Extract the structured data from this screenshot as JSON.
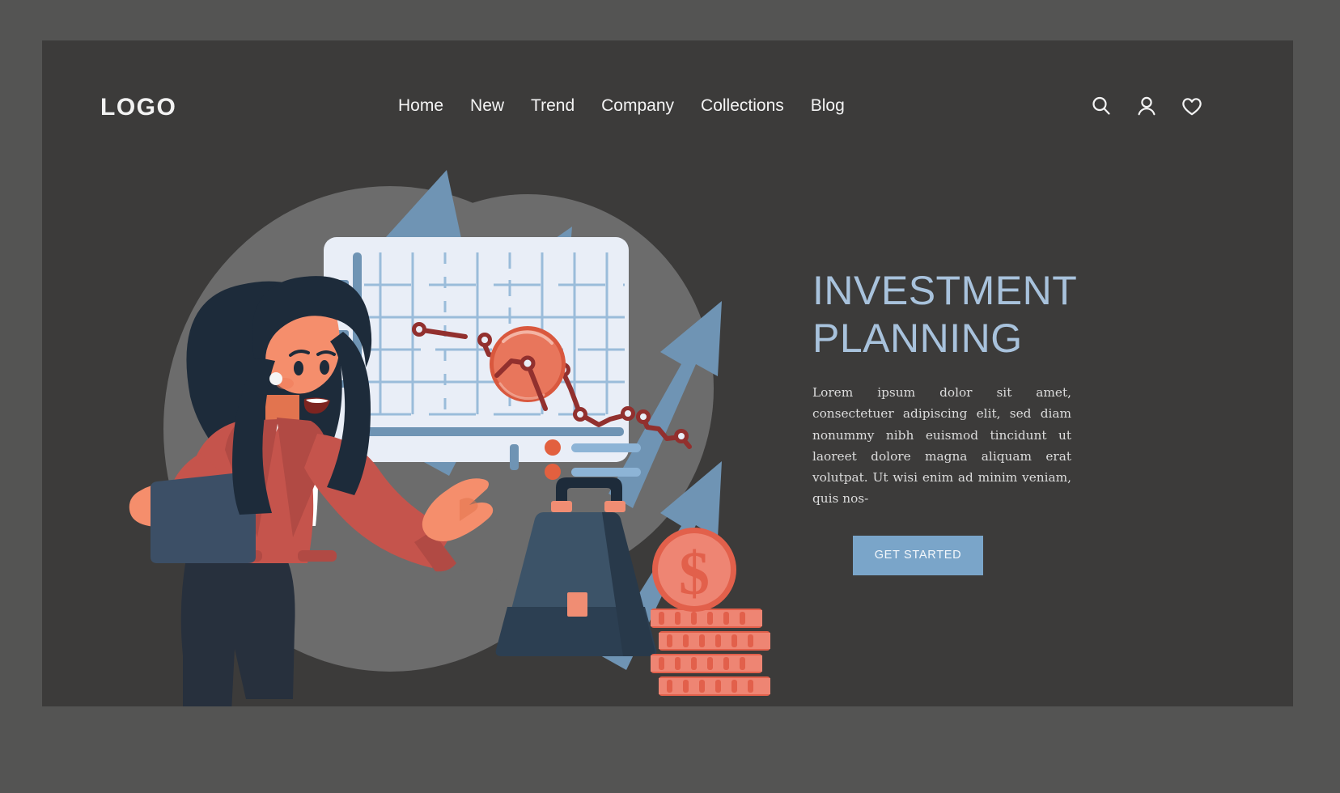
{
  "page": {
    "background_color": "#545453",
    "panel_color": "#3c3b3a"
  },
  "header": {
    "logo": "LOGO",
    "nav_items": [
      {
        "label": "Home"
      },
      {
        "label": "New"
      },
      {
        "label": "Trend"
      },
      {
        "label": "Company"
      },
      {
        "label": "Collections"
      },
      {
        "label": "Blog"
      }
    ],
    "icons": [
      {
        "name": "search-icon"
      },
      {
        "name": "user-icon"
      },
      {
        "name": "heart-icon"
      }
    ]
  },
  "hero": {
    "title": "INVESTMENT\nPLANNING",
    "title_color": "#a8c2dc",
    "paragraph": "Lorem ipsum dolor sit amet, consectetuer adipiscing elit, sed diam nonummy nibh euismod tincidunt ut laoreet dolore magna aliquam erat volutpat. Ut wisi enim ad minim veniam, quis nos-",
    "cta_label": "GET STARTED",
    "cta_background": "#7aa5c9",
    "cta_text_color": "#f3f7fb"
  },
  "illustration": {
    "name": "investment-planning-illustration",
    "colors": {
      "blob": "#6c6c6c",
      "arrow": "#6f94b4",
      "board": "#e9eef7",
      "board_axis": "#6f94b4",
      "grid_line": "#8db4d6",
      "chart_line": "#92302e",
      "magnifier": "#e8765c",
      "magnifier_ring": "#d9583e",
      "skin": "#f58e6c",
      "hair": "#1d2b3a",
      "jacket": "#c5544c",
      "jacket_dark": "#b14a44",
      "shirt": "#ffffff",
      "pants": "#27303d",
      "tablet": "#3c4f66",
      "briefcase": "#3c5368",
      "briefcase_dark": "#2c3f52",
      "briefcase_handle": "#1d2b3a",
      "coin": "#ee8573",
      "coin_edge": "#e2604b",
      "accent": "#f08d73"
    },
    "chart_data": {
      "type": "line",
      "title": "",
      "xlabel": "",
      "ylabel": "",
      "grid": true,
      "legend_position": "bottom",
      "trend": "declining",
      "x": [
        1,
        2,
        3,
        4,
        5,
        6,
        7,
        8,
        9,
        10,
        11,
        12,
        13
      ],
      "values": [
        8.6,
        8.3,
        7.4,
        7.1,
        6.3,
        6.2,
        5.9,
        4.2,
        3.9,
        4.2,
        3.3,
        3.0,
        2.1
      ],
      "markers": [
        1,
        2,
        8,
        9,
        10,
        11,
        12,
        13
      ],
      "ylim": [
        0,
        10
      ],
      "xlim": [
        0,
        14
      ],
      "series": [
        {
          "name": "series-1",
          "values": [
            8.6,
            8.3,
            7.4,
            7.1,
            6.3,
            6.2,
            5.9,
            4.2,
            3.9,
            4.2,
            3.3,
            3.0,
            2.1
          ]
        }
      ],
      "legend_rows": 2
    },
    "elements": [
      {
        "name": "background-blob"
      },
      {
        "name": "growth-arrow-1"
      },
      {
        "name": "growth-arrow-2"
      },
      {
        "name": "growth-arrow-3"
      },
      {
        "name": "growth-arrow-4"
      },
      {
        "name": "chart-board"
      },
      {
        "name": "magnifier-lens"
      },
      {
        "name": "businesswoman-figure"
      },
      {
        "name": "tablet-device"
      },
      {
        "name": "briefcase"
      },
      {
        "name": "dollar-coin"
      },
      {
        "name": "coin-stack"
      }
    ],
    "coin_symbol": "$"
  }
}
